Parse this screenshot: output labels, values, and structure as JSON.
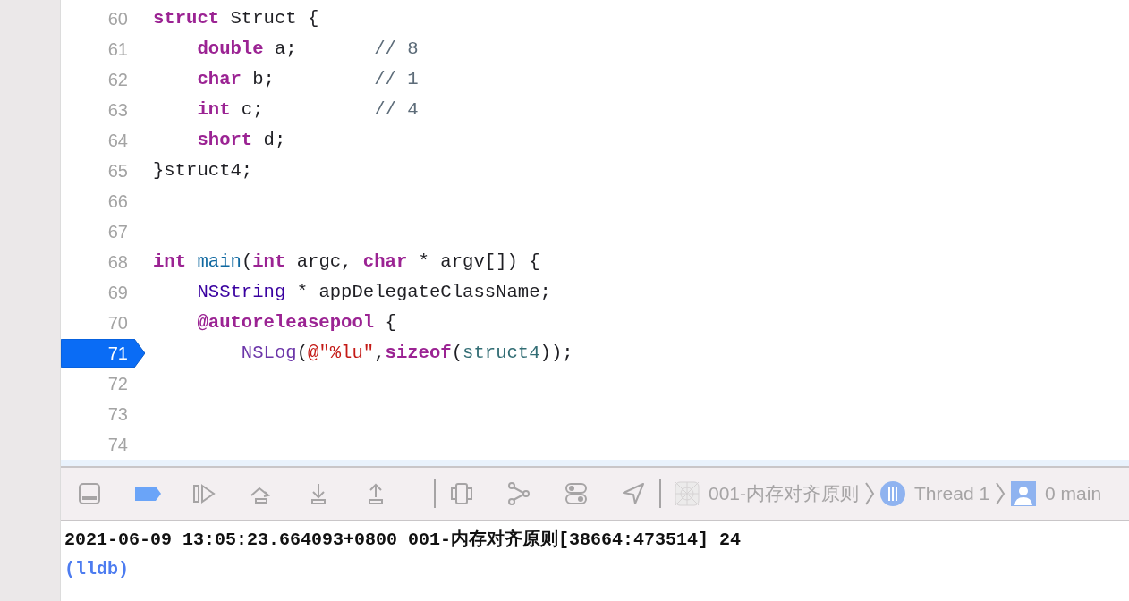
{
  "editor": {
    "lines": [
      {
        "number": "60",
        "breakpoint": false,
        "tokens": [
          {
            "text": "struct",
            "kind": "keyword"
          },
          {
            "text": " Struct {",
            "kind": "plain"
          }
        ]
      },
      {
        "number": "61",
        "breakpoint": false,
        "tokens": [
          {
            "text": "    double",
            "kind": "keyword"
          },
          {
            "text": " a;       ",
            "kind": "plain"
          },
          {
            "text": "// 8",
            "kind": "comment"
          }
        ]
      },
      {
        "number": "62",
        "breakpoint": false,
        "tokens": [
          {
            "text": "    char",
            "kind": "keyword"
          },
          {
            "text": " b;         ",
            "kind": "plain"
          },
          {
            "text": "// 1",
            "kind": "comment"
          }
        ]
      },
      {
        "number": "63",
        "breakpoint": false,
        "tokens": [
          {
            "text": "    int",
            "kind": "keyword"
          },
          {
            "text": " c;          ",
            "kind": "plain"
          },
          {
            "text": "// 4",
            "kind": "comment"
          }
        ]
      },
      {
        "number": "64",
        "breakpoint": false,
        "tokens": [
          {
            "text": "    short",
            "kind": "keyword"
          },
          {
            "text": " d;",
            "kind": "plain"
          }
        ]
      },
      {
        "number": "65",
        "breakpoint": false,
        "tokens": [
          {
            "text": "}struct4;",
            "kind": "plain"
          }
        ]
      },
      {
        "number": "66",
        "breakpoint": false
      },
      {
        "number": "67",
        "breakpoint": false
      },
      {
        "number": "68",
        "breakpoint": false,
        "tokens": [
          {
            "text": "int",
            "kind": "keyword"
          },
          {
            "text": " main",
            "kind": "declaration"
          },
          {
            "text": "(",
            "kind": "plain"
          },
          {
            "text": "int",
            "kind": "keyword"
          },
          {
            "text": " argc, ",
            "kind": "plain"
          },
          {
            "text": "char",
            "kind": "keyword"
          },
          {
            "text": " * argv[]) {",
            "kind": "plain"
          }
        ]
      },
      {
        "number": "69",
        "breakpoint": false,
        "tokens": [
          {
            "text": "    NSString",
            "kind": "type"
          },
          {
            "text": " * appDelegateClassName;",
            "kind": "plain"
          }
        ]
      },
      {
        "number": "70",
        "breakpoint": false,
        "tokens": [
          {
            "text": "    @autoreleasepool",
            "kind": "keyword"
          },
          {
            "text": " {",
            "kind": "plain"
          }
        ]
      },
      {
        "number": "71",
        "breakpoint": true,
        "tokens": [
          {
            "text": "        NSLog",
            "kind": "function"
          },
          {
            "text": "(",
            "kind": "plain"
          },
          {
            "text": "@\"%lu\"",
            "kind": "string"
          },
          {
            "text": ",",
            "kind": "plain"
          },
          {
            "text": "sizeof",
            "kind": "keyword"
          },
          {
            "text": "(",
            "kind": "plain"
          },
          {
            "text": "struct4",
            "kind": "variable"
          },
          {
            "text": "));",
            "kind": "plain"
          }
        ]
      },
      {
        "number": "72",
        "breakpoint": false
      },
      {
        "number": "73",
        "breakpoint": false
      },
      {
        "number": "74",
        "breakpoint": false
      }
    ]
  },
  "debug_bar": {
    "breakpoints_active": true,
    "breadcrumb": [
      {
        "label": "001-内存对齐原则",
        "kind": "app"
      },
      {
        "label": "Thread 1",
        "kind": "thread"
      },
      {
        "label": "0 main",
        "kind": "frame"
      }
    ]
  },
  "console": {
    "lines": [
      {
        "text": "2021-06-09 13:05:23.664093+0800 001-内存对齐原则[38664:473514] 24",
        "kind": "output"
      },
      {
        "text": "(lldb)",
        "kind": "prompt"
      }
    ]
  }
}
